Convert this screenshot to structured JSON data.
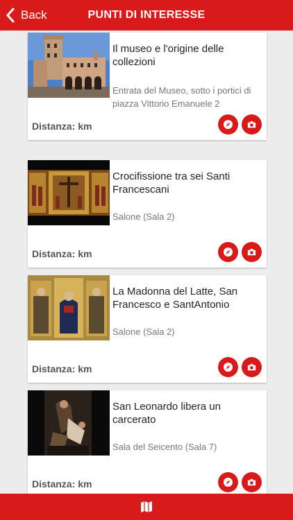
{
  "header": {
    "back_label": "Back",
    "title": "PUNTI DI INTERESSE"
  },
  "items": [
    {
      "title": "Il museo e l'origine delle collezioni",
      "subtitle": "Entrata del Museo, sotto i portici di piazza Vittorio Emanuele 2",
      "distance_label": "Distanza:",
      "distance_unit": "km"
    },
    {
      "title": "Crocifissione tra sei Santi Francescani",
      "subtitle": "Salone (Sala 2)",
      "distance_label": "Distanza:",
      "distance_unit": "km"
    },
    {
      "title": "La Madonna del Latte, San Francesco e SantAntonio",
      "subtitle": "Salone (Sala 2)",
      "distance_label": "Distanza:",
      "distance_unit": "km"
    },
    {
      "title": "San Leonardo libera un carcerato",
      "subtitle": "Sala del Seicento (Sala 7)",
      "distance_label": "Distanza:",
      "distance_unit": "km"
    }
  ],
  "colors": {
    "accent": "#d81a1a",
    "background": "#ececec",
    "card": "#ffffff"
  },
  "icons": {
    "back": "chevron-left-icon",
    "navigate": "compass-icon",
    "photo": "camera-icon",
    "footer": "map-icon"
  }
}
